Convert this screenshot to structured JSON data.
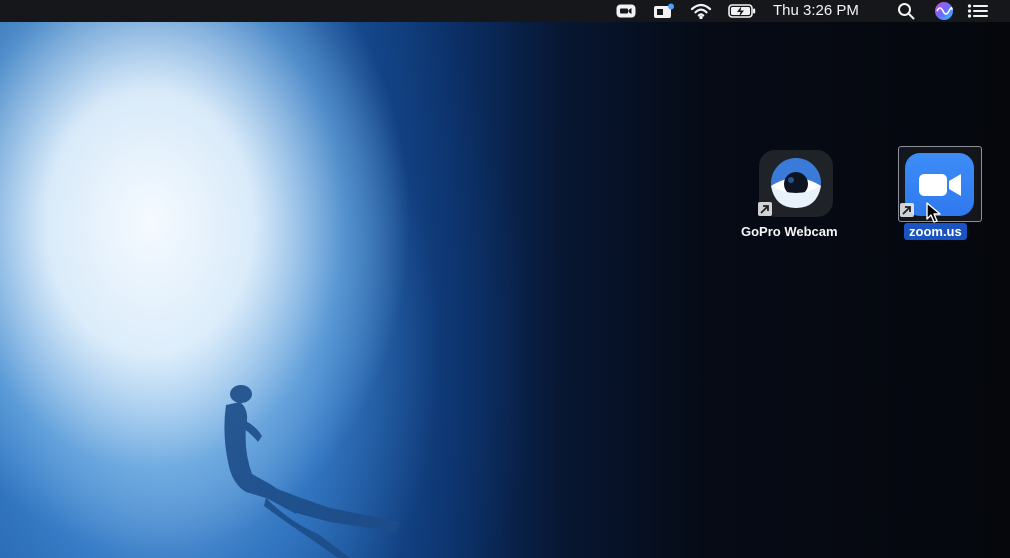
{
  "menubar": {
    "clock": "Thu 3:26 PM",
    "icons": [
      "zoom-menu-icon",
      "screen-share-icon",
      "wifi-icon",
      "battery-charging-icon",
      "spotlight-search-icon",
      "siri-icon",
      "notification-center-icon"
    ]
  },
  "desktop": {
    "icons": [
      {
        "label": "GoPro Webcam",
        "icon": "gopro-webcam-eye-icon",
        "alias": true
      },
      {
        "label": "zoom.us",
        "icon": "zoom-camera-icon",
        "alias": true,
        "selected": true
      }
    ]
  },
  "colors": {
    "menubar_bg": "#15171b",
    "zoom_blue": "#2f78ee",
    "selection_label": "#1954c2",
    "gopro_tile": "#1f2226",
    "gopro_eye": "#3a7ad8"
  }
}
